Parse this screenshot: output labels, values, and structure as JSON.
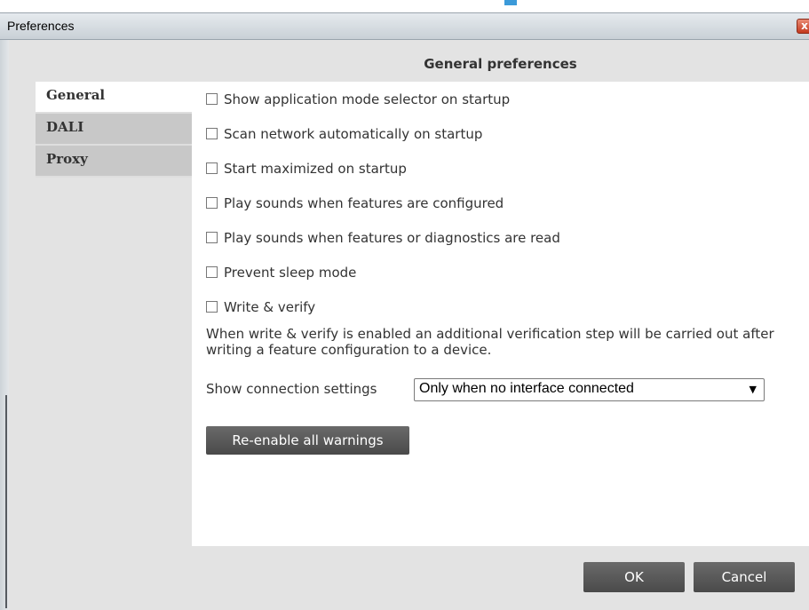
{
  "window": {
    "title": "Preferences",
    "close_glyph": "x"
  },
  "header": {
    "title": "General preferences"
  },
  "nav": {
    "items": [
      {
        "label": "General",
        "active": true
      },
      {
        "label": "DALI",
        "active": false
      },
      {
        "label": "Proxy",
        "active": false
      }
    ]
  },
  "general": {
    "options": [
      {
        "label": "Show application mode selector on startup",
        "checked": false
      },
      {
        "label": "Scan network automatically on startup",
        "checked": false
      },
      {
        "label": "Start maximized on startup",
        "checked": false
      },
      {
        "label": "Play sounds when features are configured",
        "checked": false
      },
      {
        "label": "Play sounds when features or diagnostics are read",
        "checked": false
      },
      {
        "label": "Prevent sleep mode",
        "checked": false
      },
      {
        "label": "Write & verify",
        "checked": false
      }
    ],
    "write_verify_description": "When write & verify is enabled an additional verification step will be carried out after writing a feature configuration to a device.",
    "connection_settings": {
      "label": "Show connection settings",
      "selected": "Only when no interface connected"
    },
    "reenable_warnings_label": "Re-enable all warnings"
  },
  "footer": {
    "ok_label": "OK",
    "cancel_label": "Cancel"
  },
  "colors": {
    "accent": "#3b9ad9",
    "button_dark": "#555555",
    "close_red": "#c3391e"
  }
}
